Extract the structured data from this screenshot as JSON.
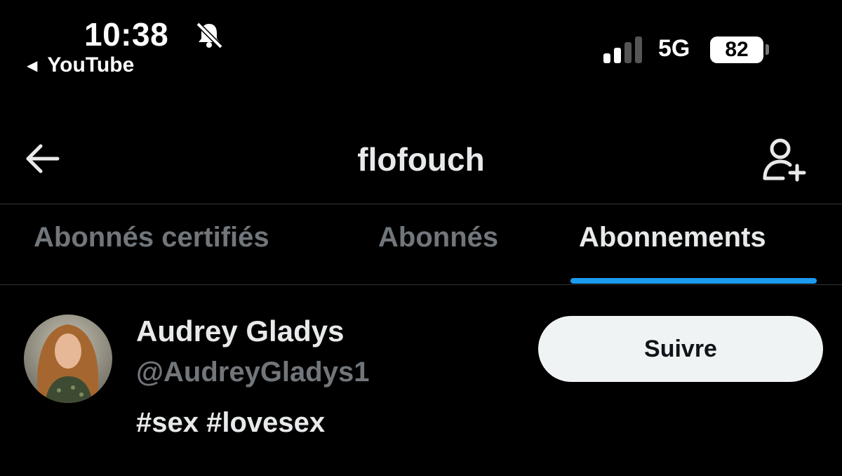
{
  "status_bar": {
    "time": "10:38",
    "back_app": "YouTube",
    "network": "5G",
    "battery": "82"
  },
  "header": {
    "title": "flofouch"
  },
  "tabs": [
    {
      "label": "Abonnés certifiés",
      "active": false
    },
    {
      "label": "Abonnés",
      "active": false
    },
    {
      "label": "Abonnements",
      "active": true
    }
  ],
  "accounts": [
    {
      "name": "Audrey Gladys",
      "handle": "@AudreyGladys1",
      "bio": "#sex #lovesex",
      "follow_label": "Suivre"
    }
  ],
  "colors": {
    "background": "#000000",
    "primary_text": "#e7e9ea",
    "secondary_text": "#71767b",
    "accent": "#1d9bf0",
    "button_bg": "#eff3f4"
  }
}
